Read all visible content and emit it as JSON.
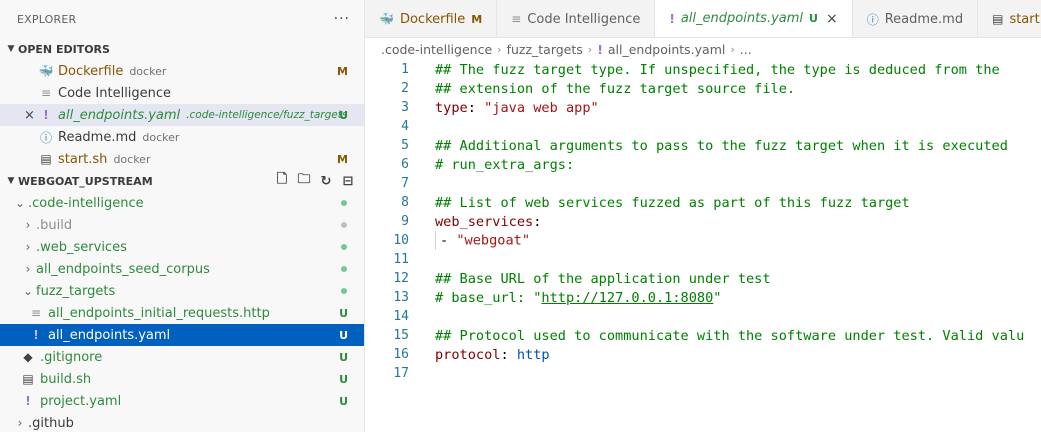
{
  "explorer": {
    "title": "EXPLORER",
    "more_label": "···"
  },
  "open_editors": {
    "header": "OPEN EDITORS",
    "items": [
      {
        "label": "Dockerfile",
        "desc": "docker",
        "badge": "M",
        "icon": "docker-icon"
      },
      {
        "label": "Code Intelligence",
        "desc": "",
        "badge": "",
        "icon": "file-lines-icon"
      },
      {
        "label": "all_endpoints.yaml",
        "desc": ".code-intelligence/fuzz_targets",
        "badge": "U",
        "icon": "yaml-exclaim-icon"
      },
      {
        "label": "Readme.md",
        "desc": "docker",
        "badge": "",
        "icon": "info-icon"
      },
      {
        "label": "start.sh",
        "desc": "docker",
        "badge": "M",
        "icon": "shell-icon"
      }
    ]
  },
  "workspace": {
    "header": "WEBGOAT_UPSTREAM",
    "tree": [
      {
        "label": ".code-intelligence",
        "badge": "",
        "dot": true
      },
      {
        "label": ".build",
        "badge": "",
        "dot": true
      },
      {
        "label": ".web_services",
        "badge": "",
        "dot": true
      },
      {
        "label": "all_endpoints_seed_corpus",
        "badge": "",
        "dot": true
      },
      {
        "label": "fuzz_targets",
        "badge": "",
        "dot": true
      },
      {
        "label": "all_endpoints_initial_requests.http",
        "badge": "U",
        "dot": false
      },
      {
        "label": "all_endpoints.yaml",
        "badge": "U",
        "dot": false
      },
      {
        "label": ".gitignore",
        "badge": "U",
        "dot": false
      },
      {
        "label": "build.sh",
        "badge": "U",
        "dot": false
      },
      {
        "label": "project.yaml",
        "badge": "U",
        "dot": false
      },
      {
        "label": ".github",
        "badge": "",
        "dot": false
      }
    ]
  },
  "tabs": [
    {
      "label": "Dockerfile",
      "badge": "M"
    },
    {
      "label": "Code Intelligence",
      "badge": ""
    },
    {
      "label": "all_endpoints.yaml",
      "badge": "U",
      "close": "×"
    },
    {
      "label": "Readme.md",
      "badge": ""
    },
    {
      "label": "start.sh",
      "badge": ""
    }
  ],
  "breadcrumb": {
    "parts": [
      ".code-intelligence",
      "fuzz_targets",
      "all_endpoints.yaml",
      "..."
    ]
  },
  "editor": {
    "line_numbers": [
      "1",
      "2",
      "3",
      "4",
      "5",
      "6",
      "7",
      "8",
      "9",
      "10",
      "11",
      "12",
      "13",
      "14",
      "15",
      "16",
      "17"
    ],
    "lines": {
      "l1": "## The fuzz target type. If unspecified, the type is deduced from the",
      "l2": "## extension of the fuzz target source file.",
      "l3_key": "type",
      "l3_colon": ": ",
      "l3_val": "\"java web app\"",
      "l5": "## Additional arguments to pass to the fuzz target when it is executed",
      "l6": "# run_extra_args:",
      "l8": "## List of web services fuzzed as part of this fuzz target",
      "l9_key": "web_services",
      "l9_colon": ":",
      "l10_dash": "- ",
      "l10_val": "\"webgoat\"",
      "l12": "## Base URL of the application under test",
      "l13_pre": "# base_url: \"",
      "l13_link": "http://127.0.0.1:8080",
      "l13_post": "\"",
      "l15": "## Protocol used to communicate with the software under test. Valid valu",
      "l16_key": "protocol",
      "l16_colon": ": ",
      "l16_val": "http"
    }
  },
  "colors": {
    "selection": "#0060c0",
    "modified": "#895503",
    "untracked": "#2e8a3d"
  }
}
